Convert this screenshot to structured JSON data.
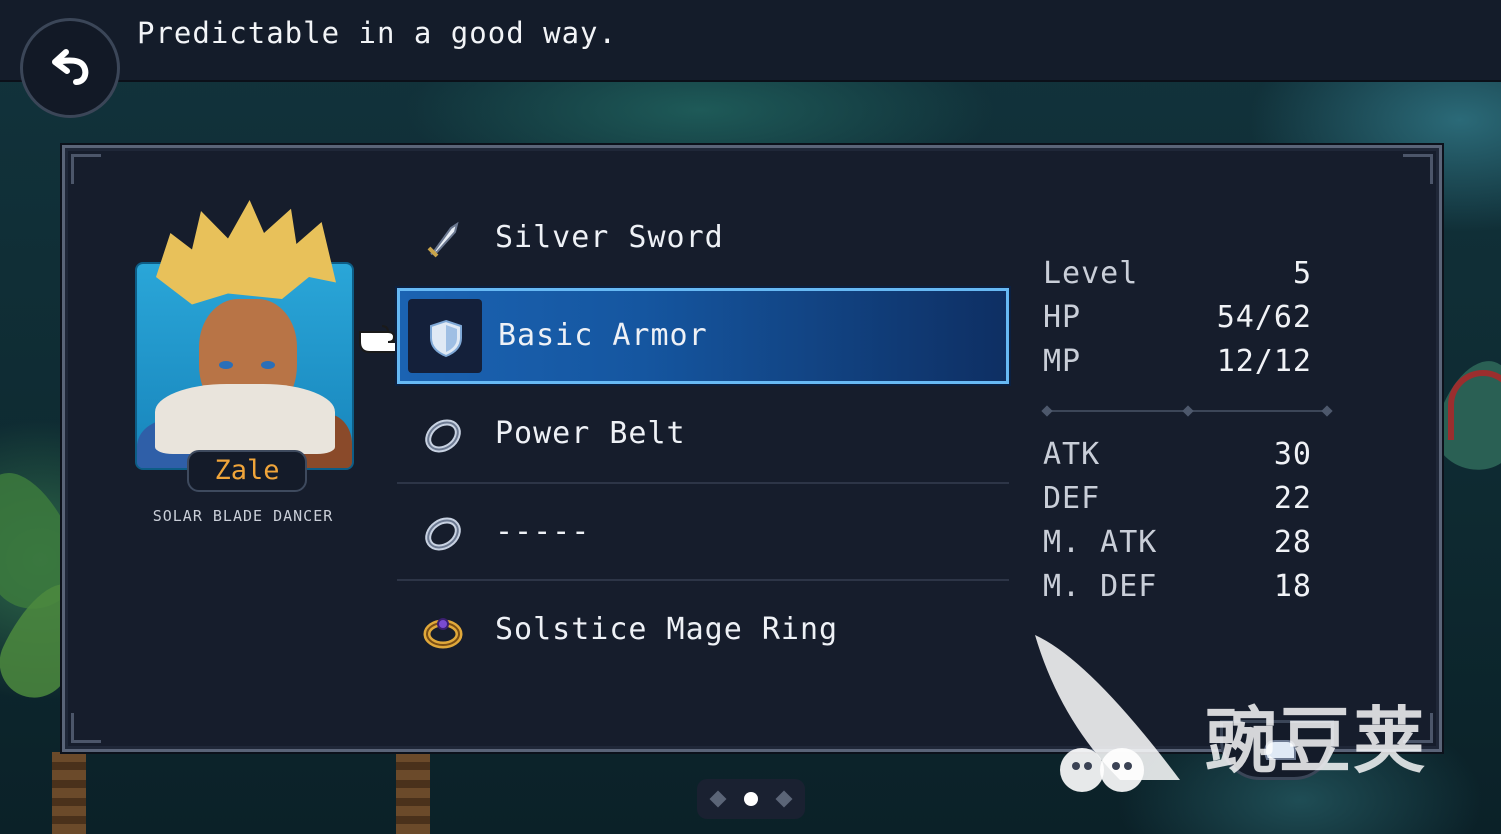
{
  "dialog": {
    "text": "Predictable in a good way."
  },
  "character": {
    "name": "Zale",
    "class": "SOLAR BLADE DANCER"
  },
  "equipment": [
    {
      "label": "Silver Sword",
      "icon": "sword-icon",
      "selected": false
    },
    {
      "label": "Basic Armor",
      "icon": "shield-icon",
      "selected": true
    },
    {
      "label": "Power Belt",
      "icon": "ring-icon",
      "selected": false
    },
    {
      "label": "-----",
      "icon": "ring-icon",
      "selected": false
    },
    {
      "label": "Solstice Mage Ring",
      "icon": "gold-ring-icon",
      "selected": false
    }
  ],
  "stats": {
    "level": {
      "label": "Level",
      "value": "5"
    },
    "hp": {
      "label": "HP",
      "value": "54/62"
    },
    "mp": {
      "label": "MP",
      "value": "12/12"
    },
    "atk": {
      "label": "ATK",
      "value": "30"
    },
    "def": {
      "label": "DEF",
      "value": "22"
    },
    "matk": {
      "label": "M. ATK",
      "value": "28"
    },
    "mdef": {
      "label": "M. DEF",
      "value": "18"
    }
  },
  "pager": {
    "pages": 3,
    "current": 2
  },
  "watermark": {
    "text": "豌豆荚"
  },
  "colors": {
    "accent": "#67b9f4",
    "selected_bg": "#1b63b2",
    "name_color": "#f0a53a",
    "panel_bg": "#161d2c"
  }
}
